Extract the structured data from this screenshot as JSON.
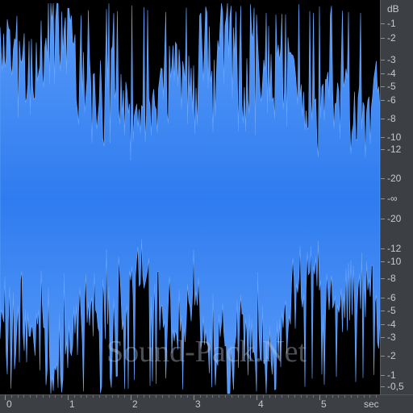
{
  "watermark": "Sound-Pack.Net",
  "colors": {
    "background": "#000000",
    "waveform": "#3f86f2",
    "waveform_edge": "#6aa8ff",
    "ruler_bg": "#3c3f44",
    "ruler_text": "#c5c8cc"
  },
  "db_ruler": {
    "unit": "dB",
    "upper": [
      "-1",
      "-2",
      "-3",
      "-4",
      "-5",
      "-6",
      "-8",
      "-10",
      "-12",
      "-20"
    ],
    "center": "-∞",
    "lower": [
      "-20",
      "-12",
      "-10",
      "-8",
      "-6",
      "-5",
      "-4",
      "-3",
      "-2",
      "-1",
      "-0,5"
    ]
  },
  "time_ruler": {
    "labels": [
      "0",
      "1",
      "2",
      "3",
      "4",
      "5"
    ],
    "unit": "sec"
  }
}
